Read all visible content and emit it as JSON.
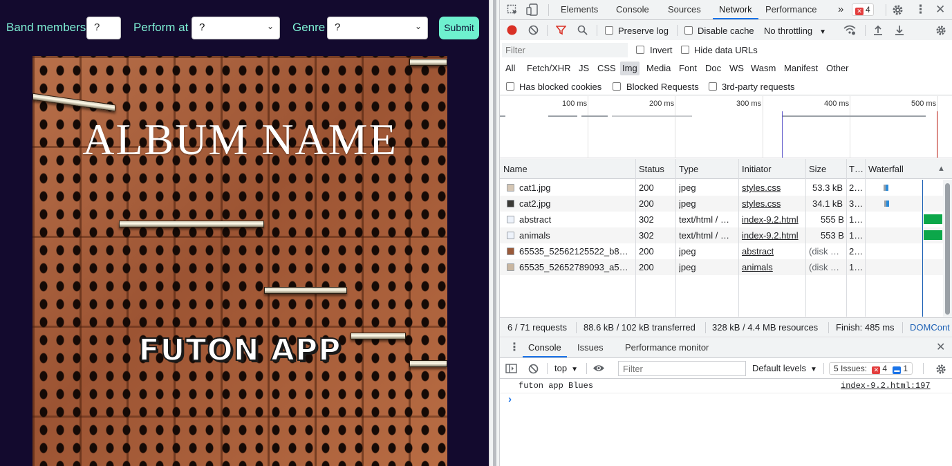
{
  "form": {
    "band_members_label": "Band members",
    "band_members_value": "?",
    "perform_at_label": "Perform at",
    "perform_at_value": "?",
    "genre_label": "Genre",
    "genre_value": "?",
    "submit_label": "Submit"
  },
  "cover": {
    "album_title": "ALBUM NAME",
    "band_name": "FUTON APP"
  },
  "devtools": {
    "tabs": [
      "Elements",
      "Console",
      "Sources",
      "Network",
      "Performance"
    ],
    "active_tab": "Network",
    "more_tabs": "»",
    "error_count": "4",
    "network_toolbar": {
      "preserve_log": "Preserve log",
      "disable_cache": "Disable cache",
      "throttling": "No throttling"
    },
    "filter": {
      "placeholder": "Filter",
      "invert": "Invert",
      "hide_data_urls": "Hide data URLs",
      "types": [
        "All",
        "Fetch/XHR",
        "JS",
        "CSS",
        "Img",
        "Media",
        "Font",
        "Doc",
        "WS",
        "Wasm",
        "Manifest",
        "Other"
      ],
      "active_type": "Img",
      "has_blocked_cookies": "Has blocked cookies",
      "blocked_requests": "Blocked Requests",
      "third_party": "3rd-party requests"
    },
    "overview": {
      "ticks": [
        "100 ms",
        "200 ms",
        "300 ms",
        "400 ms",
        "500 ms"
      ]
    },
    "table": {
      "columns": [
        "Name",
        "Status",
        "Type",
        "Initiator",
        "Size",
        "T…",
        "Waterfall"
      ],
      "rows": [
        {
          "name": "cat1.jpg",
          "status": "200",
          "type": "jpeg",
          "initiator": "styles.css",
          "size": "53.3 kB",
          "time": "2…"
        },
        {
          "name": "cat2.jpg",
          "status": "200",
          "type": "jpeg",
          "initiator": "styles.css",
          "size": "34.1 kB",
          "time": "3…"
        },
        {
          "name": "abstract",
          "status": "302",
          "type": "text/html / …",
          "initiator": "index-9.2.html",
          "size": "555 B",
          "time": "1…"
        },
        {
          "name": "animals",
          "status": "302",
          "type": "text/html / …",
          "initiator": "index-9.2.html",
          "size": "553 B",
          "time": "1…"
        },
        {
          "name": "65535_52562125522_b8…",
          "status": "200",
          "type": "jpeg",
          "initiator": "abstract",
          "size": "(disk …",
          "time": "2…"
        },
        {
          "name": "65535_52652789093_a5…",
          "status": "200",
          "type": "jpeg",
          "initiator": "animals",
          "size": "(disk …",
          "time": "1…"
        }
      ]
    },
    "summary": {
      "requests": "6 / 71 requests",
      "transferred": "88.6 kB / 102 kB transferred",
      "resources": "328 kB / 4.4 MB resources",
      "finish": "Finish: 485 ms",
      "domcontent": "DOMCont"
    },
    "drawer": {
      "tabs": [
        "Console",
        "Issues",
        "Performance monitor"
      ],
      "active_tab": "Console",
      "context": "top",
      "filter_placeholder": "Filter",
      "levels": "Default levels",
      "issues_label": "5 Issues:",
      "issues_errors": "4",
      "issues_info": "1",
      "log_message": "futon app Blues",
      "log_source": "index-9.2.html:197",
      "prompt": "›"
    },
    "colors": {
      "record_red": "#d93025",
      "accent_blue": "#1a73e8",
      "waterfall_green": "#0ca74a",
      "waterfall_blue": "#2a8ad8"
    }
  }
}
